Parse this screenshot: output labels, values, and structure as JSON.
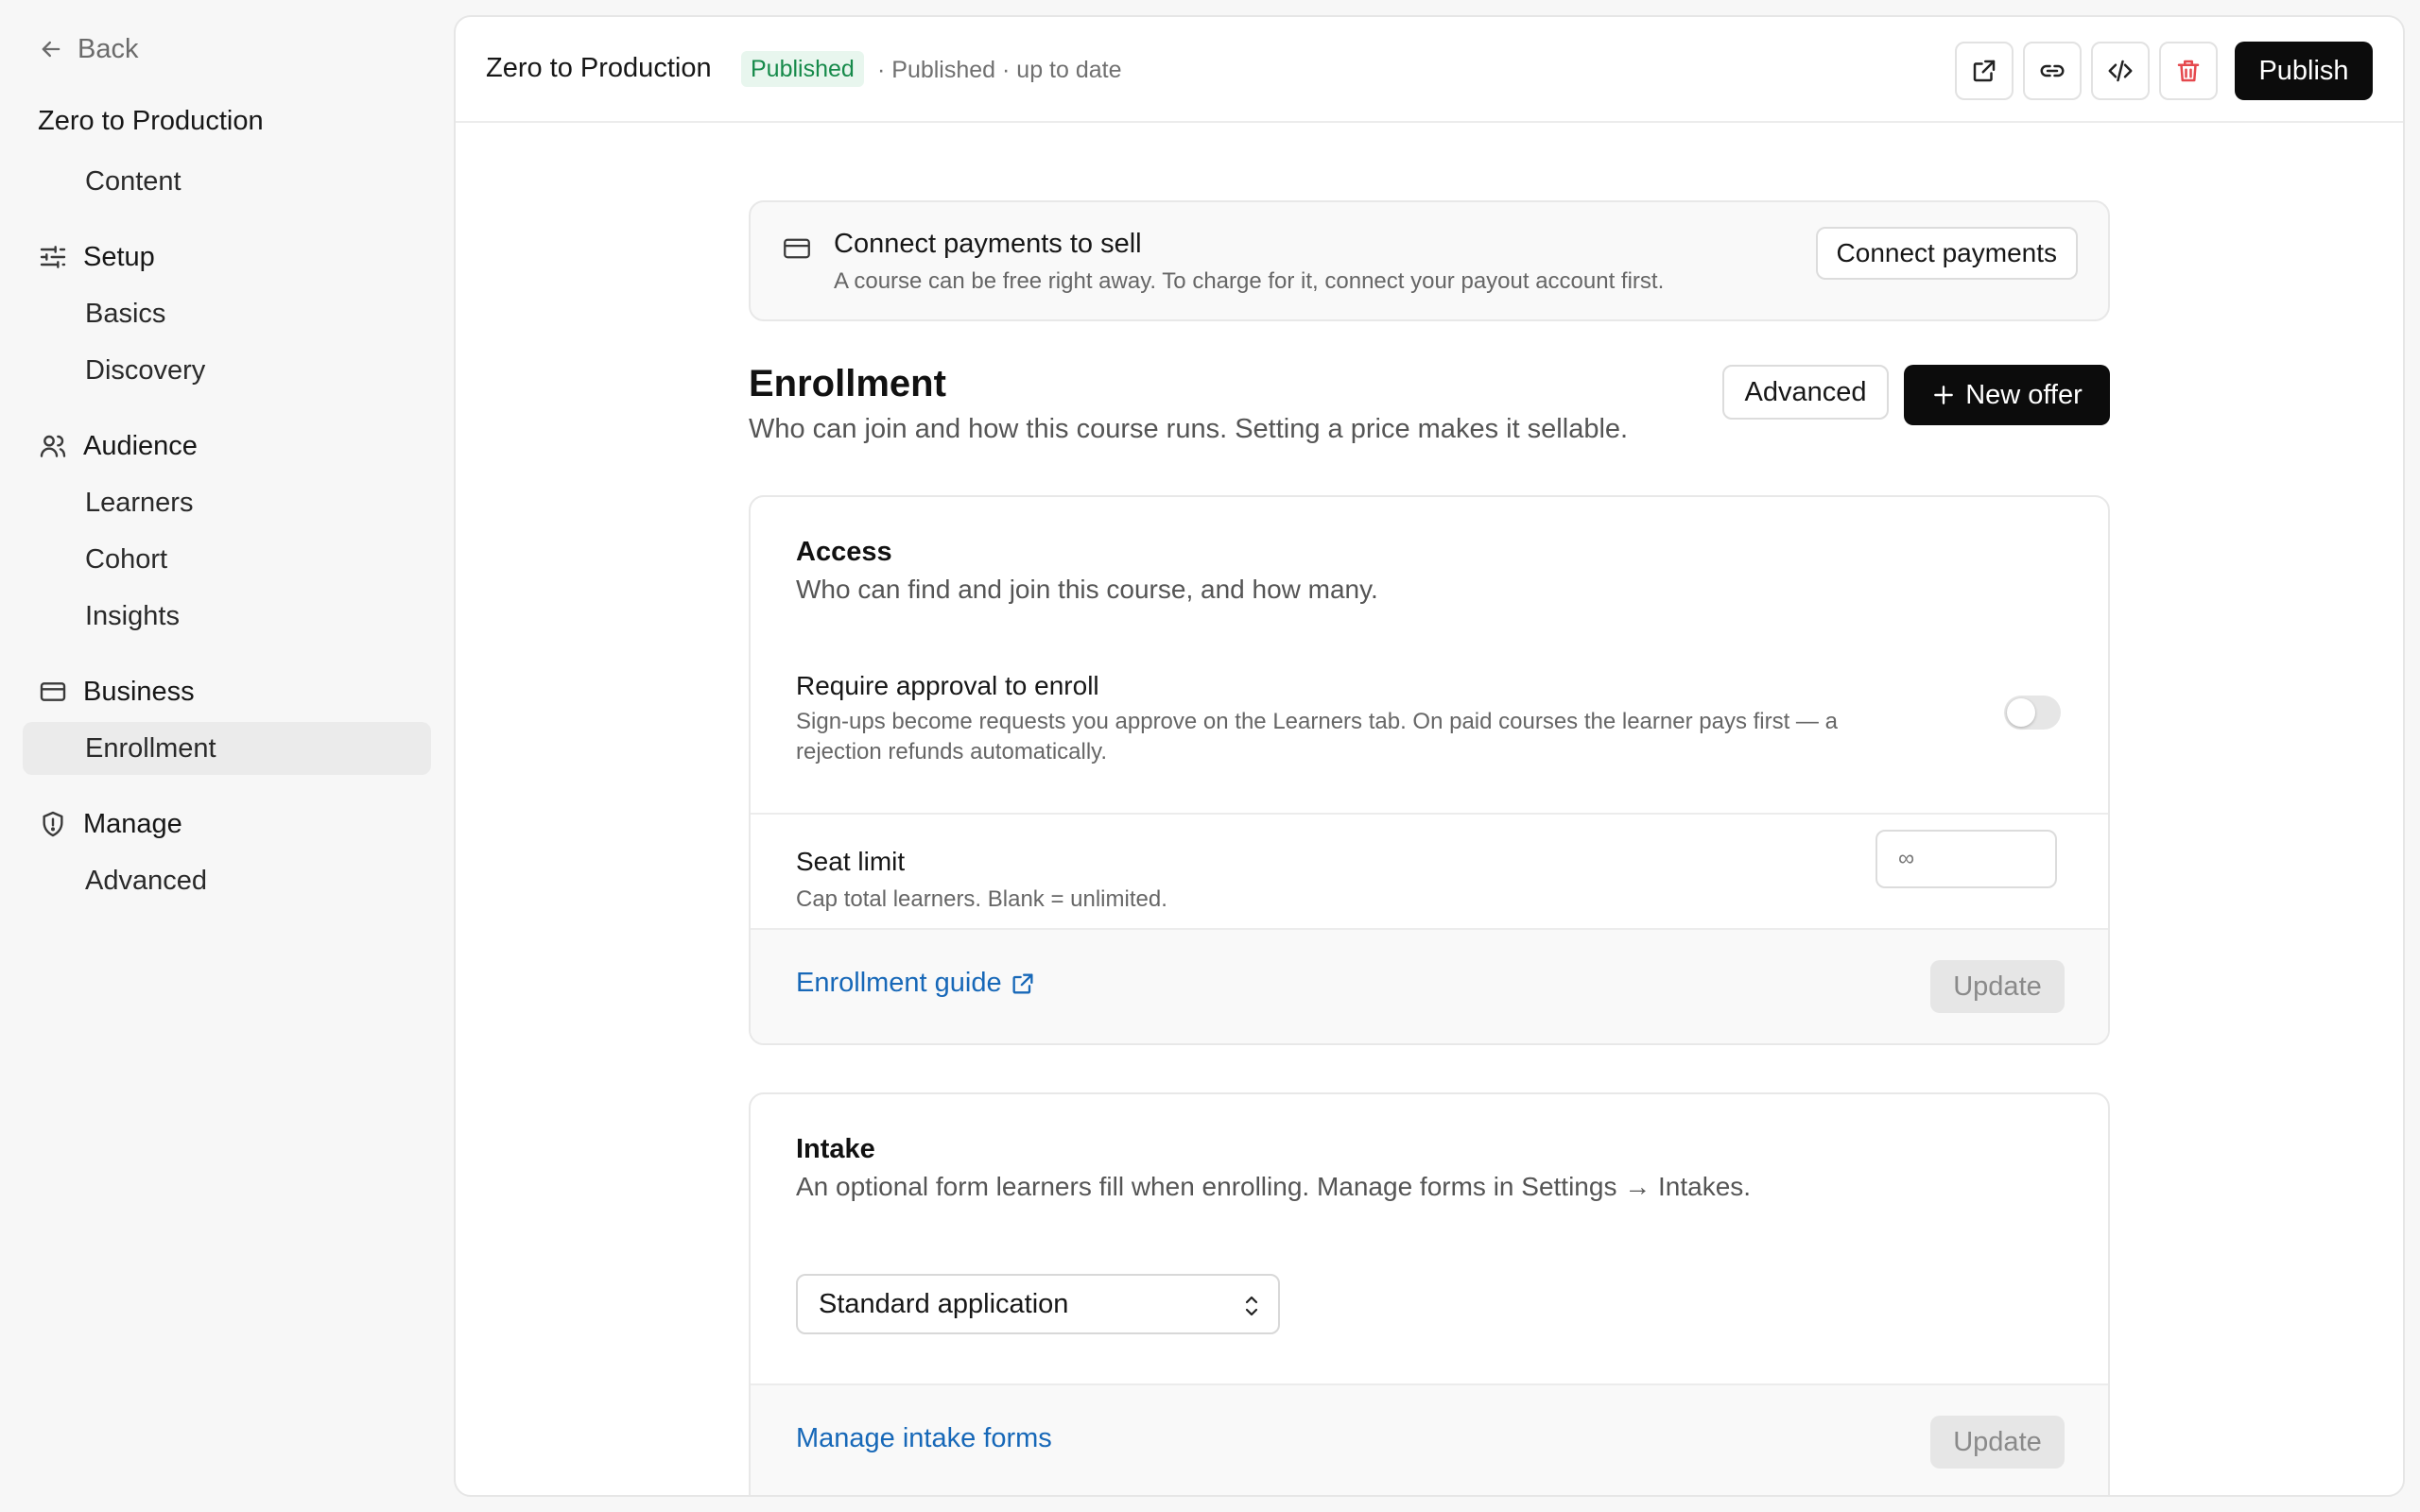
{
  "sidebar": {
    "back_label": "Back",
    "course_title": "Zero to Production",
    "content_label": "Content",
    "groups": {
      "setup": {
        "label": "Setup",
        "items": [
          "Basics",
          "Discovery"
        ]
      },
      "audience": {
        "label": "Audience",
        "items": [
          "Learners",
          "Cohort",
          "Insights"
        ]
      },
      "business": {
        "label": "Business",
        "items": [
          "Enrollment"
        ]
      },
      "manage": {
        "label": "Manage",
        "items": [
          "Advanced"
        ]
      }
    },
    "active_item": "Enrollment"
  },
  "topbar": {
    "title": "Zero to Production",
    "status_badge": "Published",
    "status_text": "· Published · up to date",
    "publish_label": "Publish"
  },
  "payments": {
    "title": "Connect payments to sell",
    "description": "A course can be free right away. To charge for it, connect your payout account first.",
    "button_label": "Connect payments"
  },
  "enrollment": {
    "title": "Enrollment",
    "description": "Who can join and how this course runs. Setting a price makes it sellable.",
    "advanced_label": "Advanced",
    "new_offer_label": "New offer"
  },
  "access": {
    "title": "Access",
    "description": "Who can find and join this course, and how many.",
    "approval_title": "Require approval to enroll",
    "approval_desc_1": "Sign-ups become requests you approve on the Learners tab. On paid courses the learner pays first — a",
    "approval_desc_2": "rejection refunds automatically.",
    "approval_enabled": false,
    "seat_title": "Seat limit",
    "seat_desc": "Cap total learners. Blank = unlimited.",
    "seat_placeholder": "∞",
    "guide_link": "Enrollment guide",
    "update_label": "Update"
  },
  "intake": {
    "title": "Intake",
    "description": "An optional form learners fill when enrolling. Manage forms in Settings → Intakes.",
    "selected_form": "Standard application",
    "manage_link": "Manage intake forms",
    "update_label": "Update"
  },
  "colors": {
    "accent": "#0c0c0c",
    "published_bg": "#e8f6ee",
    "published_text": "#168a4a",
    "link": "#1768b8",
    "delete": "#e5484d",
    "active_nav_bg": "#ebebeb"
  },
  "icons": {
    "back": "arrow-left-icon",
    "setup": "sliders-icon",
    "audience": "users-icon",
    "business": "credit-card-icon",
    "manage": "shield-icon",
    "open": "external-link-icon",
    "link": "link-icon",
    "embed": "code-icon",
    "delete": "trash-icon",
    "plus": "plus-icon",
    "select": "chevron-up-down-icon"
  }
}
